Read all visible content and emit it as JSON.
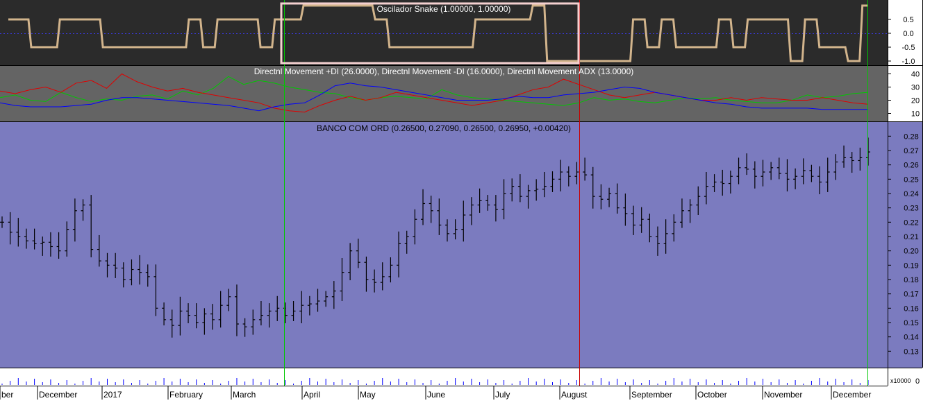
{
  "colors": {
    "osc_bg": "#2b2b2b",
    "dmi_bg": "#646464",
    "price_bg": "#7b7bbf",
    "osc_line": "#d2b48c",
    "osc_highlight": "#f4d0d0",
    "plus_di": "#00c800",
    "minus_di": "#e00000",
    "adx": "#0000ff",
    "bars": "#000000",
    "volume": "#0000ff",
    "green_marker": "#00c800",
    "red_marker": "#c80000"
  },
  "chart_data": [
    {
      "type": "line",
      "title": "Oscilador Snake (1.00000, 1.00000)",
      "ylim": [
        -1.0,
        1.0
      ],
      "yticks": [
        "0.5",
        "0.0",
        "-0.5",
        "-1.0"
      ],
      "description_series": "snake oscillator toggling between +0.5 and -0.5 with extremes at +1.0 / -1.0",
      "series": [
        {
          "values": [
            0.5,
            0.5,
            -0.5,
            -0.5,
            0.5,
            0.5,
            0.5,
            -0.5,
            -0.5,
            -0.5,
            -0.5,
            -0.5,
            -0.5,
            0.5,
            -0.5,
            0.5,
            0.5,
            0.5,
            -0.5,
            0.5,
            0.5,
            1.0,
            1.0,
            1.0,
            1.0,
            1.0,
            0.5,
            -0.5,
            -0.5,
            -0.5,
            -0.5,
            -0.5,
            -0.5,
            0.5,
            0.5,
            0.5,
            0.5,
            1.0,
            -1.0,
            -1.0,
            -1.0,
            -1.0,
            -1.0,
            -1.0,
            0.5,
            -0.5,
            0.5,
            -0.5,
            -0.5,
            -0.5,
            0.5,
            -0.5,
            0.5,
            0.5,
            0.5,
            -1.0,
            0.5,
            -0.5,
            -0.5,
            -1.0,
            1.0
          ]
        }
      ]
    },
    {
      "type": "line",
      "title": "Directnl Movement +DI (26.0000), Directnl Movement -DI (16.0000), Directnl Movement ADX (13.0000)",
      "ylim": [
        5,
        45
      ],
      "yticks": [
        "40",
        "30",
        "20",
        "10"
      ],
      "series": [
        {
          "values": [
            22,
            24,
            20,
            19,
            26,
            22,
            19,
            21,
            20,
            23,
            24,
            21,
            27,
            24,
            29,
            38,
            32,
            35,
            33,
            30,
            28,
            26,
            25,
            22,
            20,
            22,
            23,
            22,
            21,
            28,
            24,
            22,
            21,
            20,
            19,
            18,
            17,
            16,
            18,
            22,
            20,
            21,
            19,
            18,
            20,
            22,
            21,
            22,
            20,
            19,
            18,
            18,
            20,
            24,
            22,
            23,
            25,
            26
          ]
        },
        {
          "values": [
            27,
            25,
            28,
            30,
            26,
            33,
            35,
            29,
            40,
            34,
            30,
            27,
            29,
            26,
            24,
            22,
            20,
            18,
            14,
            12,
            11,
            16,
            20,
            23,
            20,
            22,
            26,
            24,
            22,
            20,
            18,
            16,
            18,
            20,
            24,
            28,
            30,
            36,
            32,
            28,
            24,
            22,
            24,
            26,
            24,
            22,
            20,
            20,
            22,
            20,
            22,
            21,
            20,
            20,
            22,
            20,
            18,
            17
          ]
        },
        {
          "values": [
            18,
            16,
            15,
            15,
            15,
            16,
            17,
            20,
            22,
            22,
            21,
            20,
            19,
            18,
            17,
            16,
            14,
            12,
            15,
            17,
            18,
            24,
            31,
            33,
            31,
            30,
            28,
            26,
            24,
            22,
            20,
            20,
            20,
            21,
            23,
            22,
            22,
            24,
            25,
            26,
            28,
            30,
            29,
            26,
            24,
            22,
            20,
            18,
            17,
            15,
            14,
            14,
            14,
            14,
            13,
            13,
            13,
            13
          ]
        }
      ]
    },
    {
      "type": "bar",
      "title": "BANCO COM ORD (0.26500, 0.27090, 0.26500, 0.26950, +0.00420)",
      "ylim": [
        0.12,
        0.285
      ],
      "yticks": [
        "0.28",
        "0.27",
        "0.26",
        "0.25",
        "0.24",
        "0.23",
        "0.22",
        "0.21",
        "0.20",
        "0.19",
        "0.18",
        "0.17",
        "0.16",
        "0.15",
        "0.14",
        "0.13"
      ],
      "xticks": [
        "ber",
        "December",
        "2017",
        "February",
        "March",
        "April",
        "May",
        "June",
        "July",
        "August",
        "September",
        "October",
        "November",
        "December"
      ],
      "values": [
        0.22,
        0.213,
        0.21,
        0.207,
        0.205,
        0.206,
        0.203,
        0.2,
        0.215,
        0.228,
        0.232,
        0.201,
        0.193,
        0.19,
        0.188,
        0.18,
        0.187,
        0.185,
        0.182,
        0.16,
        0.152,
        0.148,
        0.158,
        0.155,
        0.15,
        0.156,
        0.152,
        0.162,
        0.168,
        0.149,
        0.147,
        0.152,
        0.155,
        0.158,
        0.16,
        0.155,
        0.158,
        0.162,
        0.163,
        0.165,
        0.168,
        0.172,
        0.185,
        0.2,
        0.192,
        0.18,
        0.178,
        0.182,
        0.19,
        0.205,
        0.21,
        0.222,
        0.233,
        0.228,
        0.218,
        0.212,
        0.215,
        0.225,
        0.232,
        0.235,
        0.232,
        0.229,
        0.24,
        0.245,
        0.238,
        0.242,
        0.243,
        0.245,
        0.25,
        0.255,
        0.252,
        0.255,
        0.253,
        0.238,
        0.236,
        0.24,
        0.23,
        0.226,
        0.218,
        0.222,
        0.21,
        0.205,
        0.212,
        0.22,
        0.228,
        0.232,
        0.238,
        0.245,
        0.248,
        0.247,
        0.252,
        0.258,
        0.257,
        0.252,
        0.255,
        0.258,
        0.254,
        0.25,
        0.252,
        0.256,
        0.252,
        0.248,
        0.255,
        0.262,
        0.265,
        0.263,
        0.265,
        0.269
      ],
      "volume_unit": "x10000",
      "volume_max_label": "0"
    }
  ]
}
